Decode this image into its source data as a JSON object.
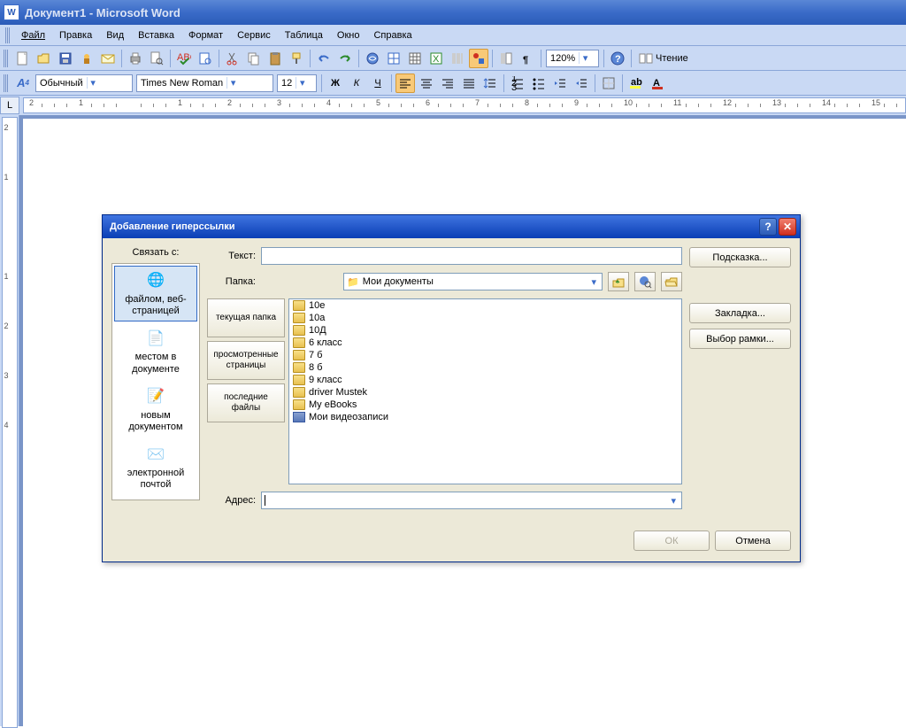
{
  "app_title": "Документ1 - Microsoft Word",
  "menu": {
    "file": "Файл",
    "edit": "Правка",
    "view": "Вид",
    "insert": "Вставка",
    "format": "Формат",
    "tools": "Сервис",
    "table": "Таблица",
    "window": "Окно",
    "help": "Справка"
  },
  "zoom": "120%",
  "read_btn": "Чтение",
  "style": "Обычный",
  "font": "Times New Roman",
  "fontsize": "12",
  "bold": "Ж",
  "italic": "К",
  "underline": "Ч",
  "ruler_marks": [
    "2",
    "1",
    "",
    "1",
    "2",
    "3",
    "4",
    "5",
    "6",
    "7",
    "8",
    "9",
    "10",
    "11",
    "12",
    "13",
    "14",
    "15"
  ],
  "vruler_marks": [
    "2",
    "1",
    "",
    "1",
    "2",
    "3",
    "4"
  ],
  "dialog": {
    "title": "Добавление гиперссылки",
    "linkto_label": "Связать с:",
    "linkto": [
      {
        "label": "файлом, веб-страницей",
        "active": true
      },
      {
        "label": "местом в документе"
      },
      {
        "label": "новым документом"
      },
      {
        "label": "электронной почтой"
      }
    ],
    "text_label": "Текст:",
    "folder_label": "Папка:",
    "folder_value": "Мои документы",
    "tabs": [
      "текущая папка",
      "просмотренные страницы",
      "последние файлы"
    ],
    "files": [
      "10е",
      "10а",
      "10Д",
      "6 класс",
      "7 б",
      "8 б",
      "9 класс",
      "driver Mustek",
      "My eBooks",
      "Мои видеозаписи"
    ],
    "address_label": "Адрес:",
    "tooltip_btn": "Подсказка...",
    "bookmark_btn": "Закладка...",
    "frame_btn": "Выбор рамки...",
    "ok": "ОК",
    "cancel": "Отмена"
  }
}
